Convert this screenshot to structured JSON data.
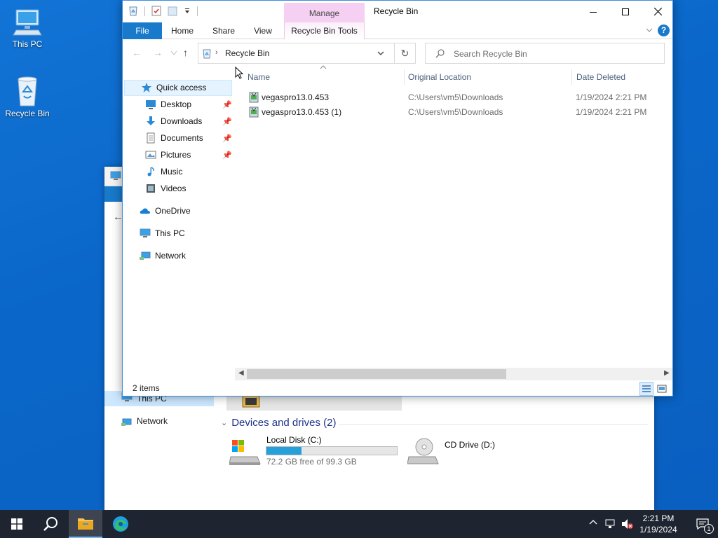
{
  "desktop": {
    "icons": [
      {
        "label": "This PC"
      },
      {
        "label": "Recycle Bin"
      }
    ]
  },
  "background_window": {
    "nav_this_pc": "This PC",
    "nav_network": "Network",
    "section_title": "Devices and drives (2)",
    "drives": [
      {
        "name": "Local Disk (C:)",
        "free_text": "72.2 GB free of 99.3 GB",
        "used_fraction": 0.27
      },
      {
        "name": "CD Drive (D:)"
      }
    ]
  },
  "window": {
    "title": "Recycle Bin",
    "manage_tab": "Manage",
    "ribbon_tabs": {
      "file": "File",
      "home": "Home",
      "share": "Share",
      "view": "View",
      "tools": "Recycle Bin Tools"
    },
    "help_label": "?",
    "address": {
      "path": "Recycle Bin"
    },
    "search": {
      "placeholder": "Search Recycle Bin"
    },
    "nav": {
      "quick_access": "Quick access",
      "desktop": "Desktop",
      "downloads": "Downloads",
      "documents": "Documents",
      "pictures": "Pictures",
      "music": "Music",
      "videos": "Videos",
      "onedrive": "OneDrive",
      "this_pc": "This PC",
      "network": "Network"
    },
    "columns": {
      "name": "Name",
      "original_location": "Original Location",
      "date_deleted": "Date Deleted"
    },
    "rows": [
      {
        "name": "vegaspro13.0.453",
        "location": "C:\\Users\\vm5\\Downloads",
        "date": "1/19/2024 2:21 PM"
      },
      {
        "name": "vegaspro13.0.453 (1)",
        "location": "C:\\Users\\vm5\\Downloads",
        "date": "1/19/2024 2:21 PM"
      }
    ],
    "status": "2 items"
  },
  "taskbar": {
    "time": "2:21 PM",
    "date": "1/19/2024",
    "notification_count": "1"
  },
  "colors": {
    "accent": "#1979ca",
    "manage_tab": "#f6d0f3",
    "taskbar": "#1e2530",
    "desktop": "#0a67c9"
  }
}
